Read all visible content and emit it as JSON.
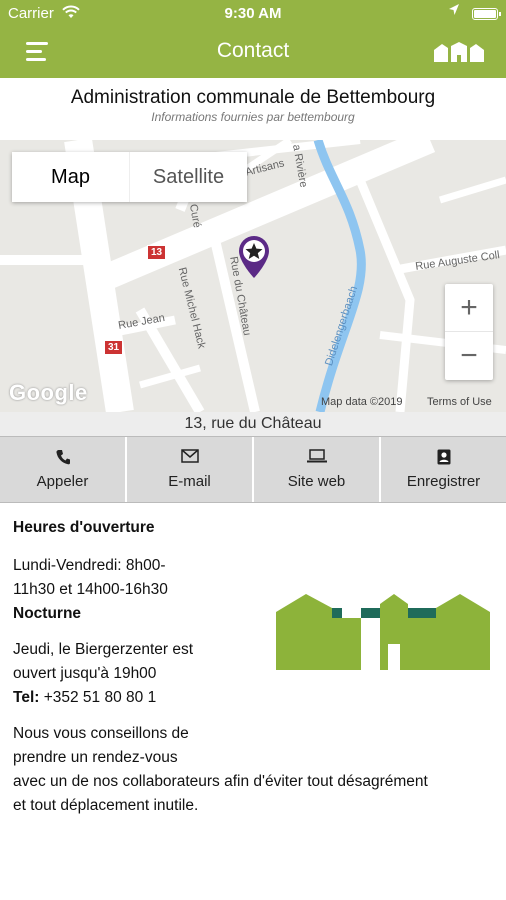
{
  "status": {
    "carrier": "Carrier",
    "time": "9:30 AM"
  },
  "nav": {
    "title": "Contact",
    "menu_icon": "hamburger-icon",
    "logo_icon": "commune-logo-icon"
  },
  "header": {
    "title": "Administration communale de Bettembourg",
    "subtitle": "Informations fournies par bettembourg"
  },
  "map": {
    "type_map": "Map",
    "type_satellite": "Satellite",
    "zoom_in": "+",
    "zoom_out": "−",
    "google": "Google",
    "data": "Map data ©2019",
    "terms": "Terms of Use",
    "streets": {
      "artisans": "Artisans",
      "riviere": "a Rivière",
      "cure": "Curé",
      "chateau": "Rue du Château",
      "michel_hack": "Rue Michel Hack",
      "jean": "Rue Jean",
      "auguste": "Rue Auguste Coll",
      "alzette": "Didelengerbaach"
    },
    "shields": [
      "13",
      "31"
    ],
    "marker_icon": "star-marker-icon"
  },
  "address": "13, rue du Château",
  "actions": [
    {
      "label": "Appeler",
      "icon": "phone-icon",
      "glyph": "✆"
    },
    {
      "label": "E-mail",
      "icon": "envelope-icon",
      "glyph": "✉"
    },
    {
      "label": "Site web",
      "icon": "laptop-icon",
      "glyph": "▭"
    },
    {
      "label": "Enregistrer",
      "icon": "contact-card-icon",
      "glyph": "▣"
    }
  ],
  "content": {
    "hours_heading": "Heures d'ouverture",
    "hours_line1": "Lundi-Vendredi: 8h00-",
    "hours_line2": "11h30 et 14h00-16h30",
    "nocturne_heading": "Nocturne",
    "nocturne_line1": "Jeudi, le Biergerzenter est",
    "nocturne_line2": "ouvert jusqu'à 19h00",
    "tel_label": "Tel:",
    "tel_value": " +352 51 80 80 1",
    "advice_line1": "Nous vous conseillons de",
    "advice_line2": "prendre un rendez-vous",
    "advice_line3": "avec un de nos collaborateurs afin d'éviter tout désagrément",
    "advice_line4": "et tout déplacement inutile."
  },
  "colors": {
    "brand": "#95b444",
    "logo_green": "#8db33a",
    "logo_teal": "#1f6b5a",
    "marker": "#5b2a86",
    "river": "#8ec5f0"
  }
}
